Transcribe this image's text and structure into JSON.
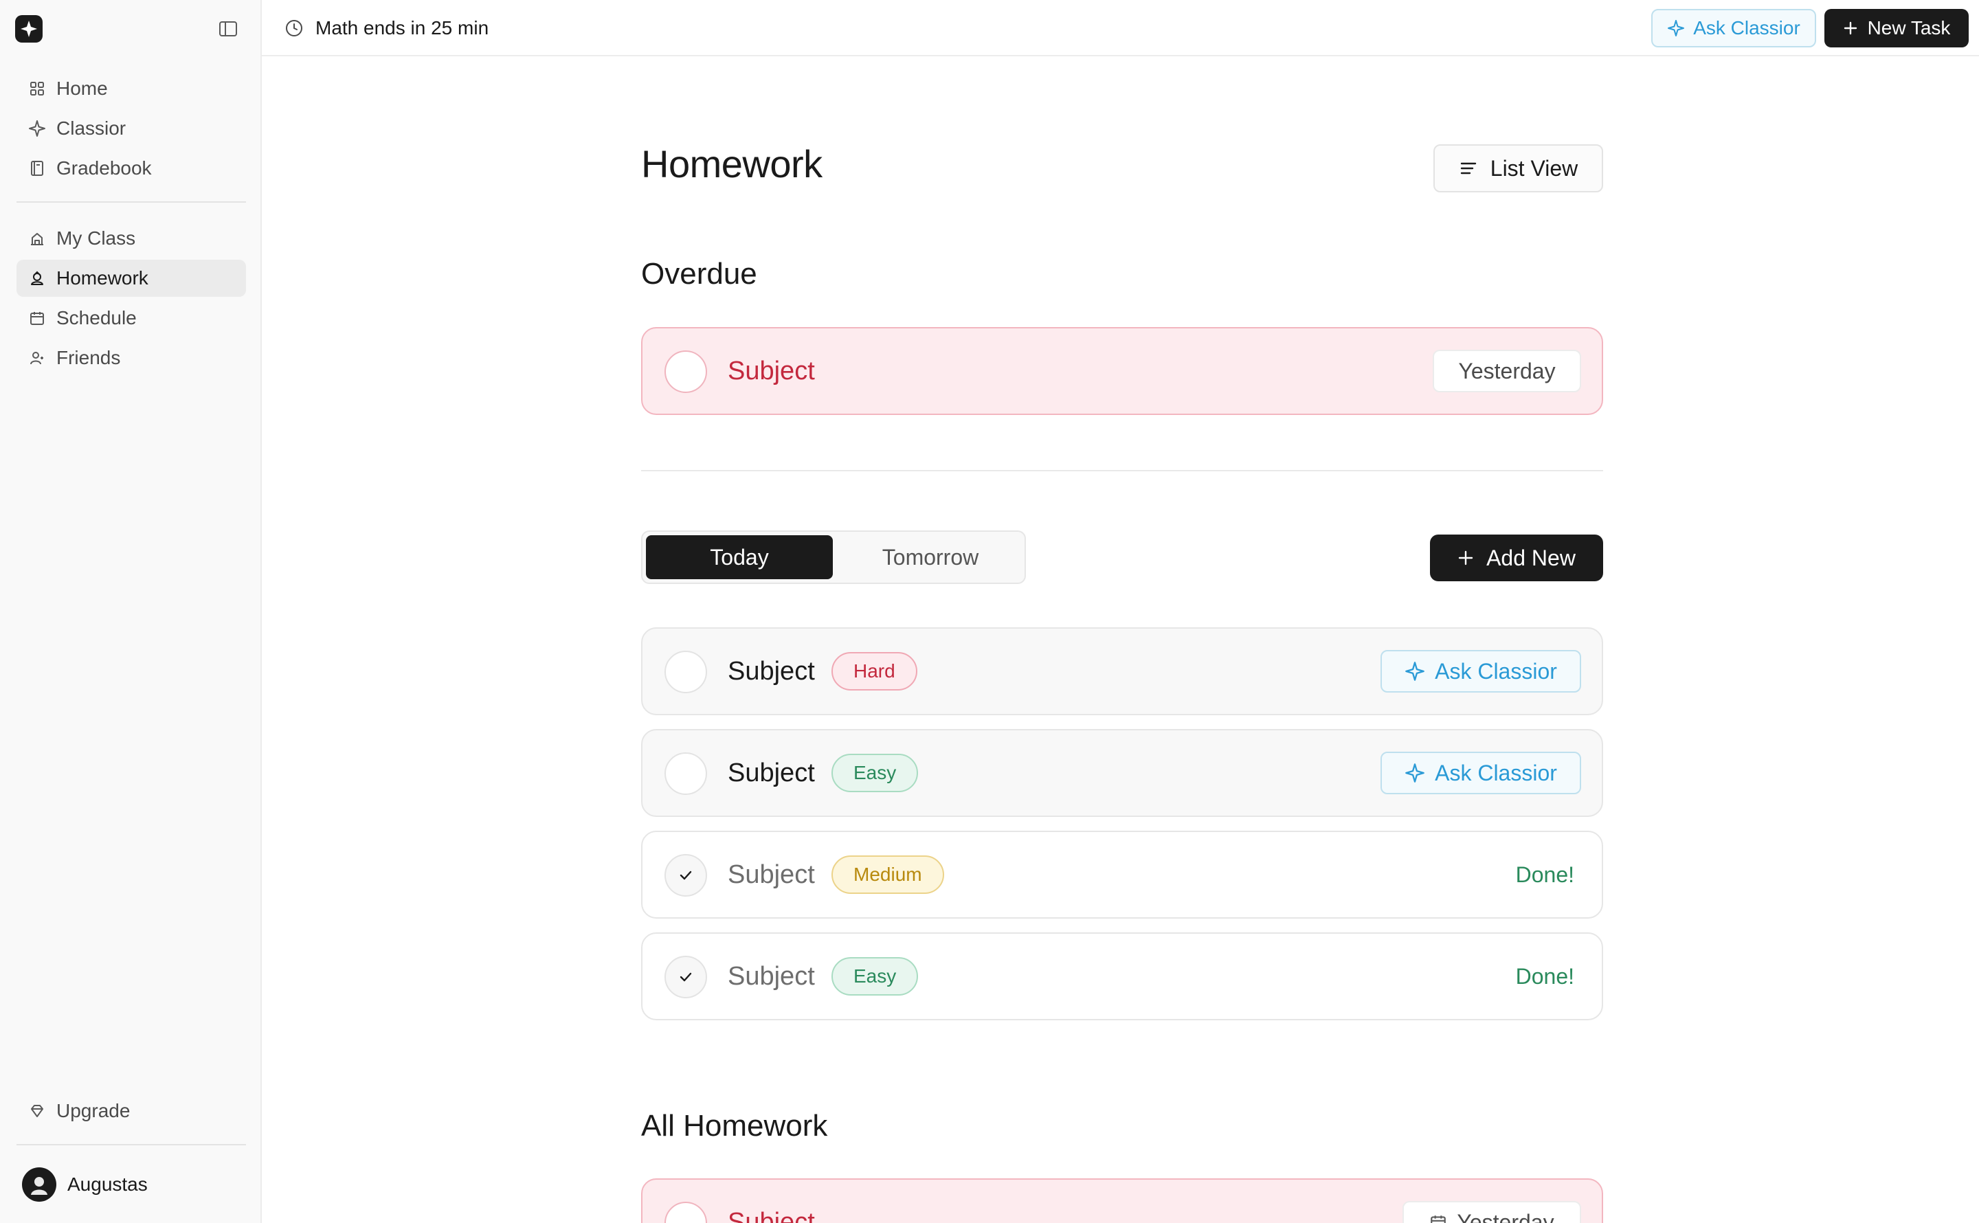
{
  "sidebar": {
    "primary_items": [
      {
        "label": "Home",
        "icon": "grid-icon"
      },
      {
        "label": "Classior",
        "icon": "sparkle-icon"
      },
      {
        "label": "Gradebook",
        "icon": "book-icon"
      }
    ],
    "secondary_items": [
      {
        "label": "My Class",
        "icon": "building-icon"
      },
      {
        "label": "Homework",
        "icon": "user-hat-icon",
        "active": true
      },
      {
        "label": "Schedule",
        "icon": "calendar-icon"
      },
      {
        "label": "Friends",
        "icon": "users-icon"
      }
    ],
    "upgrade_label": "Upgrade",
    "user_name": "Augustas"
  },
  "topbar": {
    "timer_text": "Math ends in 25 min",
    "ask_label": "Ask Classior",
    "new_task_label": "New Task"
  },
  "main": {
    "title": "Homework",
    "list_view_label": "List View",
    "overdue": {
      "title": "Overdue",
      "item": {
        "subject": "Subject",
        "date": "Yesterday"
      }
    },
    "tabs": {
      "today": "Today",
      "tomorrow": "Tomorrow",
      "active": "Today"
    },
    "add_new_label": "Add New",
    "tasks": [
      {
        "subject": "Subject",
        "difficulty": "Hard",
        "done": false,
        "action": "Ask Classior"
      },
      {
        "subject": "Subject",
        "difficulty": "Easy",
        "done": false,
        "action": "Ask Classior"
      },
      {
        "subject": "Subject",
        "difficulty": "Medium",
        "done": true,
        "status": "Done!"
      },
      {
        "subject": "Subject",
        "difficulty": "Easy",
        "done": true,
        "status": "Done!"
      }
    ],
    "all_homework": {
      "title": "All Homework",
      "item": {
        "subject": "Subject",
        "date": "Yesterday"
      }
    }
  },
  "colors": {
    "accent_dark": "#1b1b1b",
    "ask_blue": "#2a9ad6",
    "overdue_red": "#c3283d",
    "done_green": "#2a8a5c",
    "medium_yellow": "#b88a0e"
  }
}
